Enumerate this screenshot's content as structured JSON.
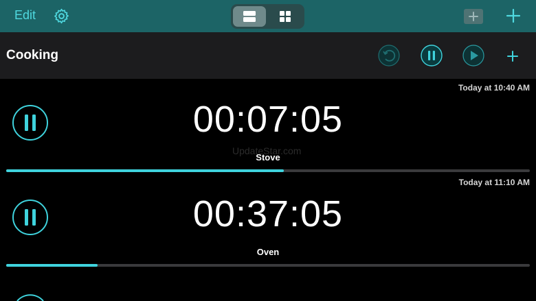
{
  "toolbar": {
    "edit_label": "Edit",
    "icons": [
      "gear-icon",
      "list-view-icon",
      "grid-view-icon",
      "add-group-icon",
      "plus-icon"
    ]
  },
  "group": {
    "title": "Cooking",
    "icons": [
      "reset-icon",
      "pause-all-icon",
      "play-all-icon",
      "add-timer-icon"
    ]
  },
  "timers": [
    {
      "date": "Today at 10:40 AM",
      "time": "00:07:05",
      "name": "Stove",
      "progress": 0.53
    },
    {
      "date": "Today at 11:10 AM",
      "time": "00:37:05",
      "name": "Oven",
      "progress": 0.175
    }
  ],
  "watermark": "UpdateStar.com",
  "colors": {
    "accent": "#3fd3dd",
    "toolbar_bg": "#1c6466",
    "header_bg": "#1c1c1e",
    "track": "#3a3a3c"
  }
}
